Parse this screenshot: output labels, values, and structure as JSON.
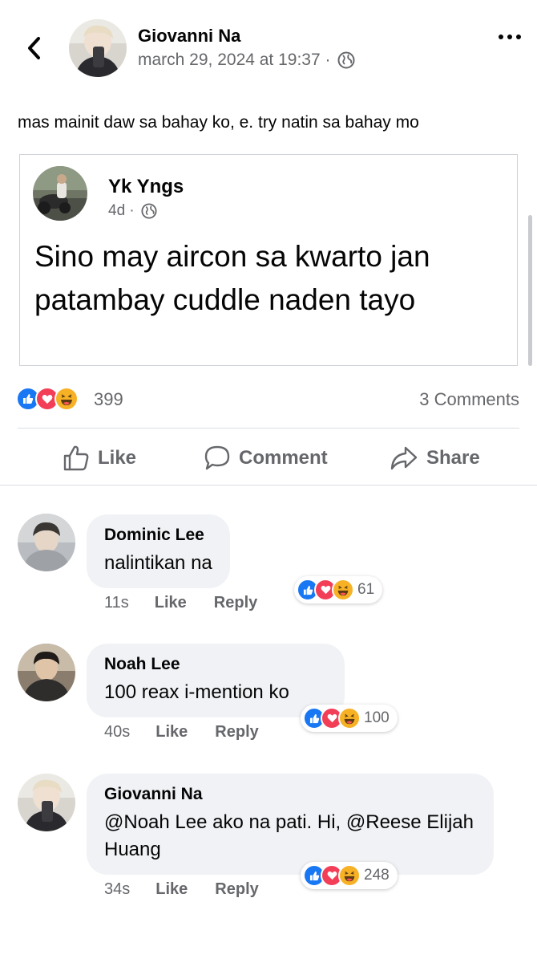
{
  "post": {
    "author": "Giovanni Na",
    "meta": "march 29, 2024 at 19:37 ·",
    "privacy_icon": "globe-icon",
    "text": "mas mainit daw sa bahay ko, e. try natin sa bahay mo",
    "shared": {
      "author": "Yk Yngs",
      "meta": "4d ·",
      "text": "Sino may aircon sa kwarto jan patambay cuddle naden tayo"
    },
    "reactions": {
      "types": [
        "like",
        "love",
        "haha"
      ],
      "count": "399"
    },
    "comments_count": "3 Comments"
  },
  "actions": {
    "like": "Like",
    "comment": "Comment",
    "share": "Share"
  },
  "comments": [
    {
      "name": "Dominic Lee",
      "text": "nalintikan na",
      "time": "11s",
      "like": "Like",
      "reply": "Reply",
      "reactions": "61"
    },
    {
      "name": "Noah Lee",
      "text": "100 reax i-mention ko",
      "time": "40s",
      "like": "Like",
      "reply": "Reply",
      "reactions": "100"
    },
    {
      "name": "Giovanni Na",
      "text": "@Noah Lee ako na pati. Hi, @Reese Elijah Huang",
      "time": "34s",
      "like": "Like",
      "reply": "Reply",
      "reactions": "248"
    }
  ],
  "colors": {
    "like": "#1877f2",
    "love": "#f33e58",
    "haha": "#f7b125",
    "secondary_text": "#65676b",
    "bubble": "#f0f2f5"
  }
}
